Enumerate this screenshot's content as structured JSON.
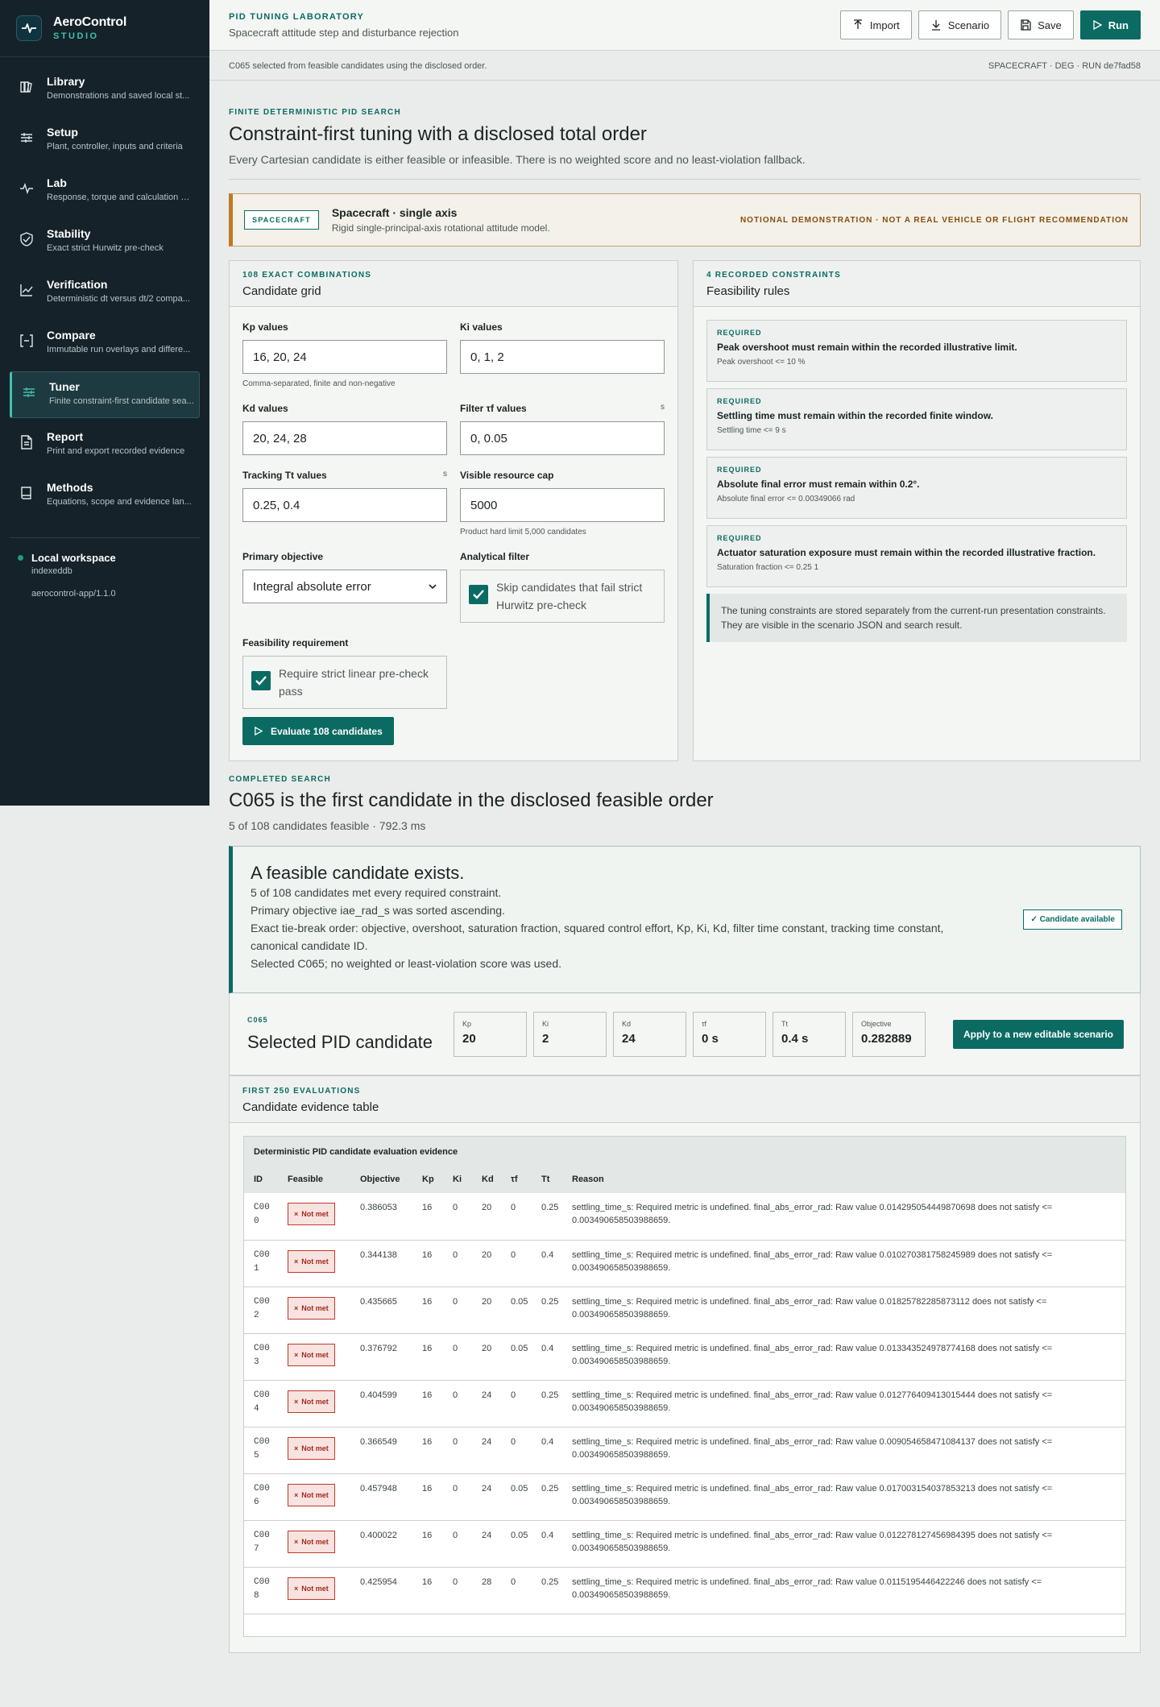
{
  "app": {
    "title": "AeroControl",
    "subtitle": "STUDIO"
  },
  "nav": [
    {
      "label": "Library",
      "desc": "Demonstrations and saved local st...",
      "icon": "library-icon"
    },
    {
      "label": "Setup",
      "desc": "Plant, controller, inputs and criteria",
      "icon": "sliders-icon"
    },
    {
      "label": "Lab",
      "desc": "Response, torque and calculation e...",
      "icon": "pulse-icon"
    },
    {
      "label": "Stability",
      "desc": "Exact strict Hurwitz pre-check",
      "icon": "shield-check-icon"
    },
    {
      "label": "Verification",
      "desc": "Deterministic dt versus dt/2 compa...",
      "icon": "chart-line-icon"
    },
    {
      "label": "Compare",
      "desc": "Immutable run overlays and differe...",
      "icon": "compare-icon"
    },
    {
      "label": "Tuner",
      "desc": "Finite constraint-first candidate sea...",
      "icon": "tuner-icon",
      "active": true
    },
    {
      "label": "Report",
      "desc": "Print and export recorded evidence",
      "icon": "document-icon"
    },
    {
      "label": "Methods",
      "desc": "Equations, scope and evidence lan...",
      "icon": "book-icon"
    }
  ],
  "workspace": {
    "title": "Local workspace",
    "storage": "indexeddb",
    "version": "aerocontrol-app/1.1.0"
  },
  "topbar": {
    "kicker": "PID TUNING LABORATORY",
    "subtitle": "Spacecraft attitude step and disturbance rejection",
    "buttons": {
      "import": "Import",
      "scenario": "Scenario",
      "save": "Save",
      "run": "Run"
    }
  },
  "status": {
    "left": "C065 selected from feasible candidates using the disclosed order.",
    "right": "SPACECRAFT · DEG · RUN de7fad58"
  },
  "intro": {
    "kicker": "FINITE DETERMINISTIC PID SEARCH",
    "title": "Constraint-first tuning with a disclosed total order",
    "text": "Every Cartesian candidate is either feasible or infeasible. There is no weighted score and no least-violation fallback."
  },
  "notice": {
    "badge": "SPACECRAFT",
    "title": "Spacecraft · single axis",
    "sub": "Rigid single-principal-axis rotational attitude model.",
    "warn": "NOTIONAL DEMONSTRATION · NOT A REAL VEHICLE OR FLIGHT RECOMMENDATION"
  },
  "grid": {
    "kicker": "108 EXACT COMBINATIONS",
    "title": "Candidate grid",
    "kp_label": "Kp values",
    "kp_value": "16, 20, 24",
    "kp_hint": "Comma-separated, finite and non-negative",
    "ki_label": "Ki values",
    "ki_value": "0, 1, 2",
    "kd_label": "Kd values",
    "kd_value": "20, 24, 28",
    "tf_label": "Filter τf values",
    "tf_unit": "s",
    "tf_value": "0, 0.05",
    "tt_label": "Tracking Tt values",
    "tt_unit": "s",
    "tt_value": "0.25, 0.4",
    "cap_label": "Visible resource cap",
    "cap_value": "5000",
    "cap_hint": "Product hard limit 5,000 candidates",
    "obj_label": "Primary objective",
    "obj_value": "Integral absolute error",
    "filter_label": "Analytical filter",
    "filter_text": "Skip candidates that fail strict Hurwitz pre-check",
    "feas_label": "Feasibility requirement",
    "feas_text": "Require strict linear pre-check pass",
    "eval_button": "Evaluate 108 candidates"
  },
  "rules": {
    "kicker": "4 RECORDED CONSTRAINTS",
    "title": "Feasibility rules",
    "items": [
      {
        "tag": "REQUIRED",
        "text": "Peak overshoot must remain within the recorded illustrative limit.",
        "metric": "Peak overshoot <= 10 %"
      },
      {
        "tag": "REQUIRED",
        "text": "Settling time must remain within the recorded finite window.",
        "metric": "Settling time <= 9 s"
      },
      {
        "tag": "REQUIRED",
        "text": "Absolute final error must remain within 0.2°.",
        "metric": "Absolute final error <= 0.00349066 rad"
      },
      {
        "tag": "REQUIRED",
        "text": "Actuator saturation exposure must remain within the recorded illustrative fraction.",
        "metric": "Saturation fraction <= 0.25 1"
      }
    ],
    "note": "The tuning constraints are stored separately from the current-run presentation constraints. They are visible in the scenario JSON and search result."
  },
  "completed": {
    "kicker": "COMPLETED SEARCH",
    "title": "C065 is the first candidate in the disclosed feasible order",
    "meta": "5 of 108 candidates feasible · 792.3 ms"
  },
  "result": {
    "title": "A feasible candidate exists.",
    "lines": [
      "5 of 108 candidates met every required constraint.",
      "Primary objective iae_rad_s was sorted ascending.",
      "Exact tie-break order: objective, overshoot, saturation fraction, squared control effort, Kp, Ki, Kd, filter time constant, tracking time constant, canonical candidate ID.",
      "Selected C065; no weighted or least-violation score was used."
    ],
    "badge": "Candidate available"
  },
  "selected": {
    "kicker": "C065",
    "title": "Selected PID candidate",
    "stats": [
      {
        "label": "Kp",
        "value": "20"
      },
      {
        "label": "Ki",
        "value": "2"
      },
      {
        "label": "Kd",
        "value": "24"
      },
      {
        "label": "τf",
        "value": "0 s"
      },
      {
        "label": "Tt",
        "value": "0.4 s"
      },
      {
        "label": "Objective",
        "value": "0.282889"
      }
    ],
    "apply": "Apply to a new editable scenario"
  },
  "evidence": {
    "kicker": "FIRST 250 EVALUATIONS",
    "title": "Candidate evidence table",
    "caption": "Deterministic PID candidate evaluation evidence",
    "headers": [
      "ID",
      "Feasible",
      "Objective",
      "Kp",
      "Ki",
      "Kd",
      "τf",
      "Tt",
      "Reason"
    ],
    "rows": [
      {
        "id": "C000",
        "feasible": "Not met",
        "objective": "0.386053",
        "kp": "16",
        "ki": "0",
        "kd": "20",
        "tf": "0",
        "tt": "0.25",
        "reason": "settling_time_s: Required metric is undefined. final_abs_error_rad: Raw value 0.014295054449870698 does not satisfy <= 0.003490658503988659."
      },
      {
        "id": "C001",
        "feasible": "Not met",
        "objective": "0.344138",
        "kp": "16",
        "ki": "0",
        "kd": "20",
        "tf": "0",
        "tt": "0.4",
        "reason": "settling_time_s: Required metric is undefined. final_abs_error_rad: Raw value 0.010270381758245989 does not satisfy <= 0.003490658503988659."
      },
      {
        "id": "C002",
        "feasible": "Not met",
        "objective": "0.435665",
        "kp": "16",
        "ki": "0",
        "kd": "20",
        "tf": "0.05",
        "tt": "0.25",
        "reason": "settling_time_s: Required metric is undefined. final_abs_error_rad: Raw value 0.01825782285873112 does not satisfy <= 0.003490658503988659."
      },
      {
        "id": "C003",
        "feasible": "Not met",
        "objective": "0.376792",
        "kp": "16",
        "ki": "0",
        "kd": "20",
        "tf": "0.05",
        "tt": "0.4",
        "reason": "settling_time_s: Required metric is undefined. final_abs_error_rad: Raw value 0.013343524978774168 does not satisfy <= 0.003490658503988659."
      },
      {
        "id": "C004",
        "feasible": "Not met",
        "objective": "0.404599",
        "kp": "16",
        "ki": "0",
        "kd": "24",
        "tf": "0",
        "tt": "0.25",
        "reason": "settling_time_s: Required metric is undefined. final_abs_error_rad: Raw value 0.012776409413015444 does not satisfy <= 0.003490658503988659."
      },
      {
        "id": "C005",
        "feasible": "Not met",
        "objective": "0.366549",
        "kp": "16",
        "ki": "0",
        "kd": "24",
        "tf": "0",
        "tt": "0.4",
        "reason": "settling_time_s: Required metric is undefined. final_abs_error_rad: Raw value 0.009054658471084137 does not satisfy <= 0.003490658503988659."
      },
      {
        "id": "C006",
        "feasible": "Not met",
        "objective": "0.457948",
        "kp": "16",
        "ki": "0",
        "kd": "24",
        "tf": "0.05",
        "tt": "0.25",
        "reason": "settling_time_s: Required metric is undefined. final_abs_error_rad: Raw value 0.017003154037853213 does not satisfy <= 0.003490658503988659."
      },
      {
        "id": "C007",
        "feasible": "Not met",
        "objective": "0.400022",
        "kp": "16",
        "ki": "0",
        "kd": "24",
        "tf": "0.05",
        "tt": "0.4",
        "reason": "settling_time_s: Required metric is undefined. final_abs_error_rad: Raw value 0.012278127456984395 does not satisfy <= 0.003490658503988659."
      },
      {
        "id": "C008",
        "feasible": "Not met",
        "objective": "0.425954",
        "kp": "16",
        "ki": "0",
        "kd": "28",
        "tf": "0",
        "tt": "0.25",
        "reason": "settling_time_s: Required metric is undefined. final_abs_error_rad: Raw value 0.0115195446422246 does not satisfy <= 0.003490658503988659."
      }
    ]
  }
}
